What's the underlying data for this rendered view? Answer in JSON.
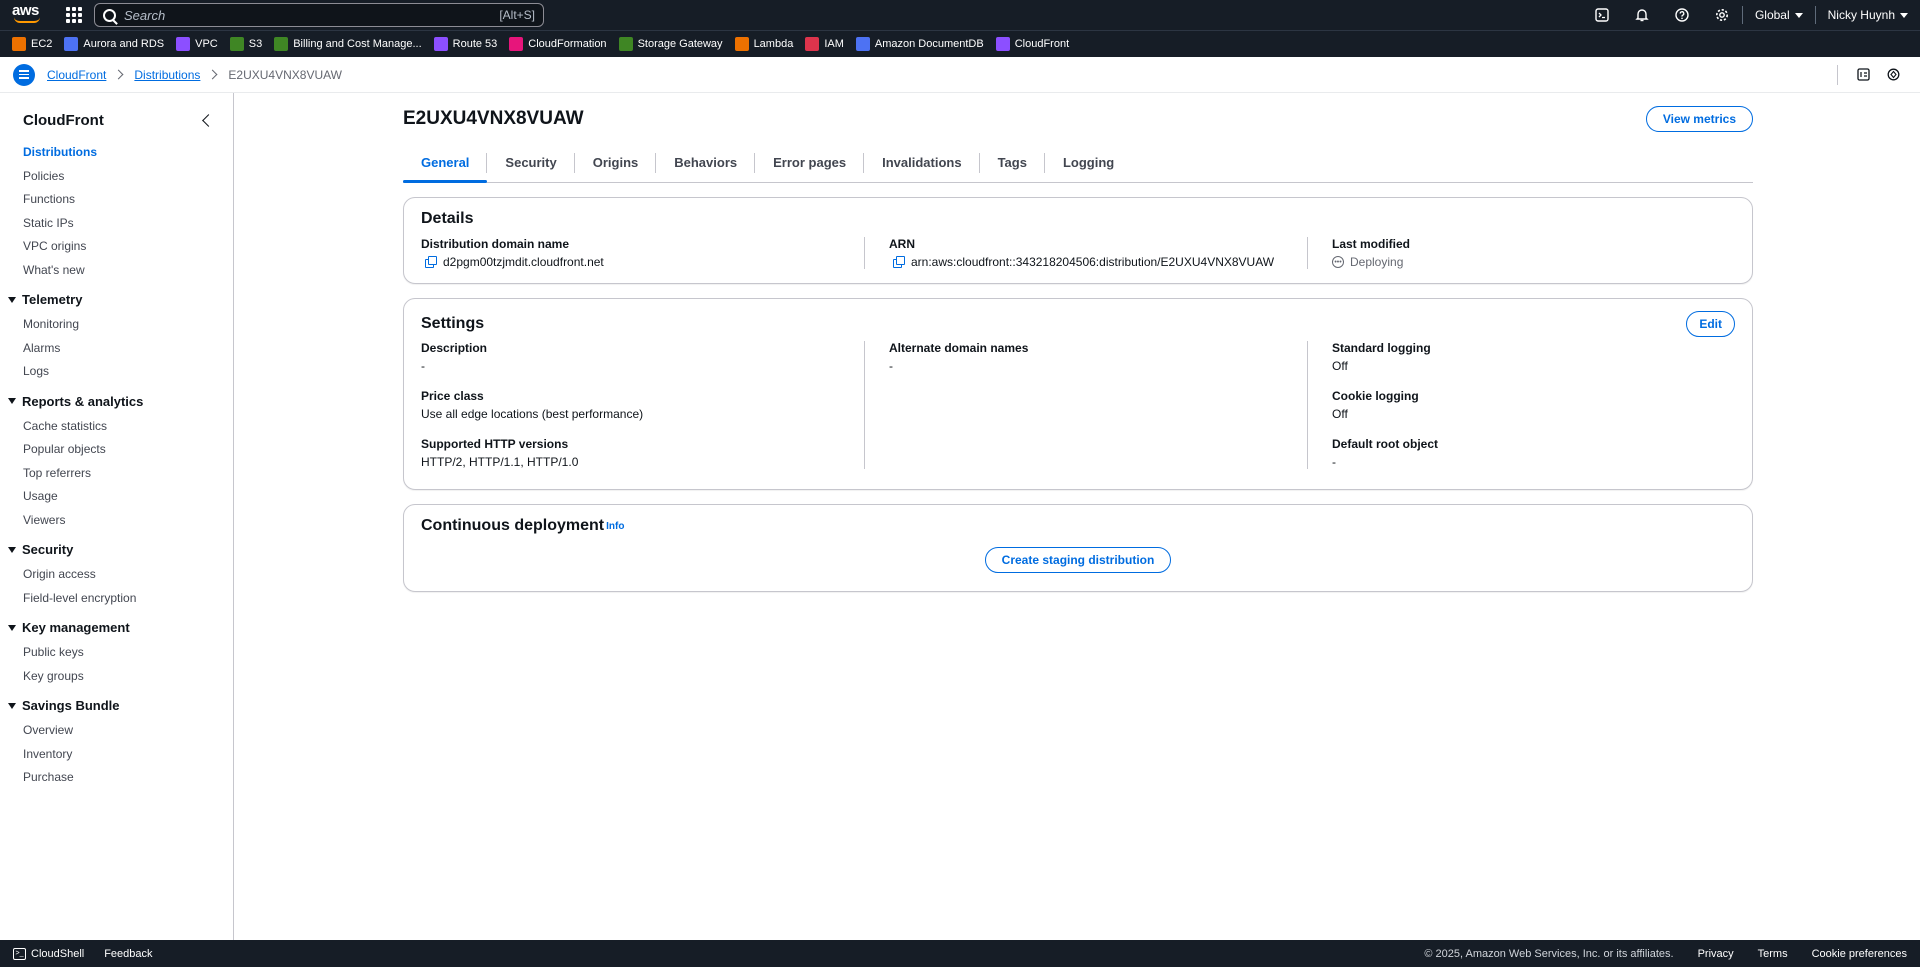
{
  "topnav": {
    "search_placeholder": "Search",
    "search_shortcut": "[Alt+S]",
    "region": "Global",
    "user": "Nicky Huynh"
  },
  "favorites": [
    {
      "label": "EC2",
      "color": "#ed7100"
    },
    {
      "label": "Aurora and RDS",
      "color": "#4d72f3"
    },
    {
      "label": "VPC",
      "color": "#8c4fff"
    },
    {
      "label": "S3",
      "color": "#3f8624"
    },
    {
      "label": "Billing and Cost Manage...",
      "color": "#3f8624"
    },
    {
      "label": "Route 53",
      "color": "#8c4fff"
    },
    {
      "label": "CloudFormation",
      "color": "#e7157b"
    },
    {
      "label": "Storage Gateway",
      "color": "#3f8624"
    },
    {
      "label": "Lambda",
      "color": "#ed7100"
    },
    {
      "label": "IAM",
      "color": "#dd344c"
    },
    {
      "label": "Amazon DocumentDB",
      "color": "#4d72f3"
    },
    {
      "label": "CloudFront",
      "color": "#8c4fff"
    }
  ],
  "breadcrumb": {
    "items": [
      "CloudFront",
      "Distributions"
    ],
    "current": "E2UXU4VNX8VUAW"
  },
  "sidebar": {
    "title": "CloudFront",
    "top_items": [
      "Distributions",
      "Policies",
      "Functions",
      "Static IPs",
      "VPC origins",
      "What's new"
    ],
    "sections": [
      {
        "title": "Telemetry",
        "items": [
          "Monitoring",
          "Alarms",
          "Logs"
        ]
      },
      {
        "title": "Reports & analytics",
        "items": [
          "Cache statistics",
          "Popular objects",
          "Top referrers",
          "Usage",
          "Viewers"
        ]
      },
      {
        "title": "Security",
        "items": [
          "Origin access",
          "Field-level encryption"
        ]
      },
      {
        "title": "Key management",
        "items": [
          "Public keys",
          "Key groups"
        ]
      },
      {
        "title": "Savings Bundle",
        "items": [
          "Overview",
          "Inventory",
          "Purchase"
        ]
      }
    ]
  },
  "page": {
    "title": "E2UXU4VNX8VUAW",
    "view_metrics": "View metrics",
    "tabs": [
      "General",
      "Security",
      "Origins",
      "Behaviors",
      "Error pages",
      "Invalidations",
      "Tags",
      "Logging"
    ]
  },
  "details": {
    "title": "Details",
    "domain_label": "Distribution domain name",
    "domain_value": "d2pgm00tzjmdit.cloudfront.net",
    "arn_label": "ARN",
    "arn_value": "arn:aws:cloudfront::343218204506:distribution/E2UXU4VNX8VUAW",
    "modified_label": "Last modified",
    "modified_value": "Deploying"
  },
  "settings": {
    "title": "Settings",
    "edit": "Edit",
    "description_label": "Description",
    "description_value": "-",
    "price_label": "Price class",
    "price_value": "Use all edge locations (best performance)",
    "http_label": "Supported HTTP versions",
    "http_value": "HTTP/2, HTTP/1.1, HTTP/1.0",
    "alt_label": "Alternate domain names",
    "alt_value": "-",
    "std_log_label": "Standard logging",
    "std_log_value": "Off",
    "cookie_label": "Cookie logging",
    "cookie_value": "Off",
    "root_label": "Default root object",
    "root_value": "-"
  },
  "continuous": {
    "title": "Continuous deployment",
    "info": "Info",
    "button": "Create staging distribution"
  },
  "footer": {
    "cloudshell": "CloudShell",
    "feedback": "Feedback",
    "copyright": "© 2025, Amazon Web Services, Inc. or its affiliates.",
    "privacy": "Privacy",
    "terms": "Terms",
    "cookies": "Cookie preferences"
  }
}
